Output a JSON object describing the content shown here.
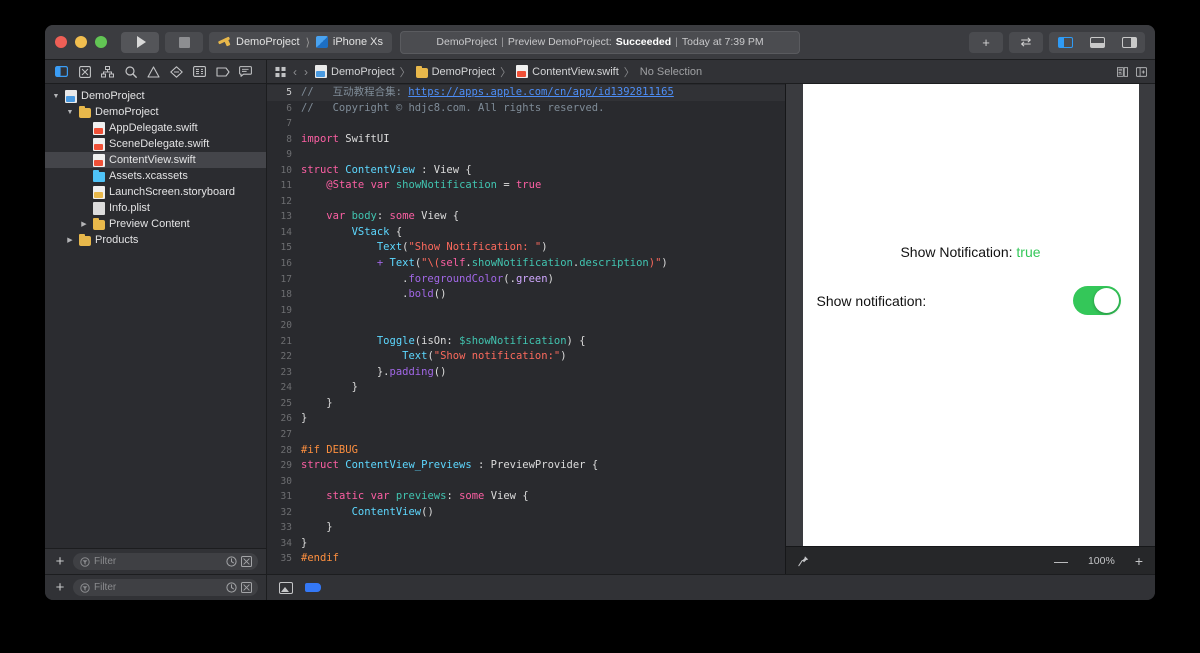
{
  "window": {
    "traffic_lights": [
      "close",
      "minimize",
      "maximize"
    ],
    "run_button_label": "Run",
    "stop_button_label": "Stop",
    "scheme": {
      "target": "DemoProject",
      "device": "iPhone Xs"
    },
    "status": {
      "project": "DemoProject",
      "sep": "|",
      "activity": "Preview DemoProject:",
      "result": "Succeeded",
      "time": "Today at 7:39 PM"
    },
    "toolbar_right": {
      "add_label": "+",
      "swap_label": "⇄",
      "panel_left": "navigator",
      "panel_bottom": "debug-area",
      "panel_right": "inspector"
    }
  },
  "navigator": {
    "toolbar_icons": [
      "project-navigator-icon",
      "source-control-navigator-icon",
      "symbol-navigator-icon",
      "find-navigator-icon",
      "issue-navigator-icon",
      "test-navigator-icon",
      "debug-navigator-icon",
      "breakpoint-navigator-icon",
      "report-navigator-icon"
    ],
    "tree": [
      {
        "label": "DemoProject",
        "indent": 0,
        "icon": "project-file-icon",
        "twisty": "open",
        "selected": false
      },
      {
        "label": "DemoProject",
        "indent": 1,
        "icon": "folder-icon",
        "twisty": "open",
        "selected": false
      },
      {
        "label": "AppDelegate.swift",
        "indent": 2,
        "icon": "swift-file-icon",
        "twisty": "none",
        "selected": false
      },
      {
        "label": "SceneDelegate.swift",
        "indent": 2,
        "icon": "swift-file-icon",
        "twisty": "none",
        "selected": false
      },
      {
        "label": "ContentView.swift",
        "indent": 2,
        "icon": "swift-file-icon",
        "twisty": "none",
        "selected": true
      },
      {
        "label": "Assets.xcassets",
        "indent": 2,
        "icon": "assets-icon",
        "twisty": "none",
        "selected": false
      },
      {
        "label": "LaunchScreen.storyboard",
        "indent": 2,
        "icon": "storyboard-file-icon",
        "twisty": "none",
        "selected": false
      },
      {
        "label": "Info.plist",
        "indent": 2,
        "icon": "plist-file-icon",
        "twisty": "none",
        "selected": false
      },
      {
        "label": "Preview Content",
        "indent": 2,
        "icon": "folder-icon",
        "twisty": "closed",
        "selected": false
      },
      {
        "label": "Products",
        "indent": 1,
        "icon": "folder-icon",
        "twisty": "closed",
        "selected": false
      }
    ],
    "filter": {
      "placeholder": "Filter",
      "add_label": "+"
    }
  },
  "jumpbar": {
    "back_label": "‹",
    "forward_label": "›",
    "crumbs": [
      "DemoProject",
      "DemoProject",
      "ContentView.swift",
      "No Selection"
    ],
    "separator": "〉"
  },
  "editor": {
    "language": "Swift",
    "highlighted_line": 5,
    "lines": [
      {
        "n": 5,
        "highlighted": true,
        "tokens": [
          {
            "t": "//   互动教程合集: ",
            "c": "c"
          },
          {
            "t": "https://apps.apple.com/cn/app/id1392811165",
            "c": "u"
          }
        ]
      },
      {
        "n": 6,
        "tokens": [
          {
            "t": "//   Copyright © hdjc8.com. All rights reserved.",
            "c": "c"
          }
        ]
      },
      {
        "n": 7,
        "tokens": []
      },
      {
        "n": 8,
        "tokens": [
          {
            "t": "import",
            "c": "k"
          },
          {
            "t": " SwiftUI",
            "c": "pl"
          }
        ]
      },
      {
        "n": 9,
        "tokens": []
      },
      {
        "n": 10,
        "tokens": [
          {
            "t": "struct",
            "c": "k"
          },
          {
            "t": " ",
            "c": "pl"
          },
          {
            "t": "ContentView",
            "c": "t"
          },
          {
            "t": " : ",
            "c": "pl"
          },
          {
            "t": "View",
            "c": "pl"
          },
          {
            "t": " {",
            "c": "pl"
          }
        ]
      },
      {
        "n": 11,
        "tokens": [
          {
            "t": "    ",
            "c": "pl"
          },
          {
            "t": "@State",
            "c": "at"
          },
          {
            "t": " ",
            "c": "pl"
          },
          {
            "t": "var",
            "c": "k"
          },
          {
            "t": " ",
            "c": "pl"
          },
          {
            "t": "showNotification",
            "c": "v"
          },
          {
            "t": " = ",
            "c": "pl"
          },
          {
            "t": "true",
            "c": "k"
          }
        ]
      },
      {
        "n": 12,
        "tokens": []
      },
      {
        "n": 13,
        "tokens": [
          {
            "t": "    ",
            "c": "pl"
          },
          {
            "t": "var",
            "c": "k"
          },
          {
            "t": " ",
            "c": "pl"
          },
          {
            "t": "body",
            "c": "v"
          },
          {
            "t": ": ",
            "c": "pl"
          },
          {
            "t": "some",
            "c": "k"
          },
          {
            "t": " View {",
            "c": "pl"
          }
        ]
      },
      {
        "n": 14,
        "tokens": [
          {
            "t": "        ",
            "c": "pl"
          },
          {
            "t": "VStack",
            "c": "t"
          },
          {
            "t": " {",
            "c": "pl"
          }
        ]
      },
      {
        "n": 15,
        "tokens": [
          {
            "t": "            ",
            "c": "pl"
          },
          {
            "t": "Text",
            "c": "t"
          },
          {
            "t": "(",
            "c": "pl"
          },
          {
            "t": "\"Show Notification: \"",
            "c": "s"
          },
          {
            "t": ")",
            "c": "pl"
          }
        ]
      },
      {
        "n": 16,
        "tokens": [
          {
            "t": "            + ",
            "c": "m"
          },
          {
            "t": "Text",
            "c": "t"
          },
          {
            "t": "(",
            "c": "pl"
          },
          {
            "t": "\"\\(",
            "c": "s"
          },
          {
            "t": "self",
            "c": "k"
          },
          {
            "t": ".",
            "c": "pl"
          },
          {
            "t": "showNotification",
            "c": "v"
          },
          {
            "t": ".",
            "c": "pl"
          },
          {
            "t": "description",
            "c": "v"
          },
          {
            "t": ")\"",
            "c": "s"
          },
          {
            "t": ")",
            "c": "pl"
          }
        ]
      },
      {
        "n": 17,
        "tokens": [
          {
            "t": "                .",
            "c": "pl"
          },
          {
            "t": "foregroundColor",
            "c": "m"
          },
          {
            "t": "(.",
            "c": "pl"
          },
          {
            "t": "green",
            "c": "p"
          },
          {
            "t": ")",
            "c": "pl"
          }
        ]
      },
      {
        "n": 18,
        "tokens": [
          {
            "t": "                .",
            "c": "pl"
          },
          {
            "t": "bold",
            "c": "m"
          },
          {
            "t": "()",
            "c": "pl"
          }
        ]
      },
      {
        "n": 19,
        "tokens": []
      },
      {
        "n": 20,
        "tokens": []
      },
      {
        "n": 21,
        "tokens": [
          {
            "t": "            ",
            "c": "pl"
          },
          {
            "t": "Toggle",
            "c": "t"
          },
          {
            "t": "(",
            "c": "pl"
          },
          {
            "t": "isOn",
            "c": "pl"
          },
          {
            "t": ": ",
            "c": "pl"
          },
          {
            "t": "$showNotification",
            "c": "v"
          },
          {
            "t": ") {",
            "c": "pl"
          }
        ]
      },
      {
        "n": 22,
        "tokens": [
          {
            "t": "                ",
            "c": "pl"
          },
          {
            "t": "Text",
            "c": "t"
          },
          {
            "t": "(",
            "c": "pl"
          },
          {
            "t": "\"Show notification:\"",
            "c": "s"
          },
          {
            "t": ")",
            "c": "pl"
          }
        ]
      },
      {
        "n": 23,
        "tokens": [
          {
            "t": "            }.",
            "c": "pl"
          },
          {
            "t": "padding",
            "c": "m"
          },
          {
            "t": "()",
            "c": "pl"
          }
        ]
      },
      {
        "n": 24,
        "tokens": [
          {
            "t": "        }",
            "c": "pl"
          }
        ]
      },
      {
        "n": 25,
        "tokens": [
          {
            "t": "    }",
            "c": "pl"
          }
        ]
      },
      {
        "n": 26,
        "tokens": [
          {
            "t": "}",
            "c": "pl"
          }
        ]
      },
      {
        "n": 27,
        "tokens": []
      },
      {
        "n": 28,
        "tokens": [
          {
            "t": "#if DEBUG",
            "c": "pre"
          }
        ]
      },
      {
        "n": 29,
        "tokens": [
          {
            "t": "struct",
            "c": "k"
          },
          {
            "t": " ",
            "c": "pl"
          },
          {
            "t": "ContentView_Previews",
            "c": "t"
          },
          {
            "t": " : ",
            "c": "pl"
          },
          {
            "t": "PreviewProvider",
            "c": "pl"
          },
          {
            "t": " {",
            "c": "pl"
          }
        ]
      },
      {
        "n": 30,
        "tokens": []
      },
      {
        "n": 31,
        "tokens": [
          {
            "t": "    ",
            "c": "pl"
          },
          {
            "t": "static",
            "c": "k"
          },
          {
            "t": " ",
            "c": "pl"
          },
          {
            "t": "var",
            "c": "k"
          },
          {
            "t": " ",
            "c": "pl"
          },
          {
            "t": "previews",
            "c": "v"
          },
          {
            "t": ": ",
            "c": "pl"
          },
          {
            "t": "some",
            "c": "k"
          },
          {
            "t": " View {",
            "c": "pl"
          }
        ]
      },
      {
        "n": 32,
        "tokens": [
          {
            "t": "        ",
            "c": "pl"
          },
          {
            "t": "ContentView",
            "c": "t"
          },
          {
            "t": "()",
            "c": "pl"
          }
        ]
      },
      {
        "n": 33,
        "tokens": [
          {
            "t": "    }",
            "c": "pl"
          }
        ]
      },
      {
        "n": 34,
        "tokens": [
          {
            "t": "}",
            "c": "pl"
          }
        ]
      },
      {
        "n": 35,
        "tokens": [
          {
            "t": "#endif",
            "c": "pre"
          }
        ]
      }
    ]
  },
  "preview": {
    "text_label": "Show Notification: ",
    "text_value": "true",
    "toggle_label": "Show notification:",
    "toggle_on": true,
    "accent_green": "#34c759",
    "bottom": {
      "pin_icon": "pin-icon",
      "zoom_out": "—",
      "zoom_level": "100%",
      "zoom_in": "+"
    }
  },
  "bottom_bar": {
    "library_icon": "image-library-icon",
    "tag_icon": "tag-icon"
  }
}
